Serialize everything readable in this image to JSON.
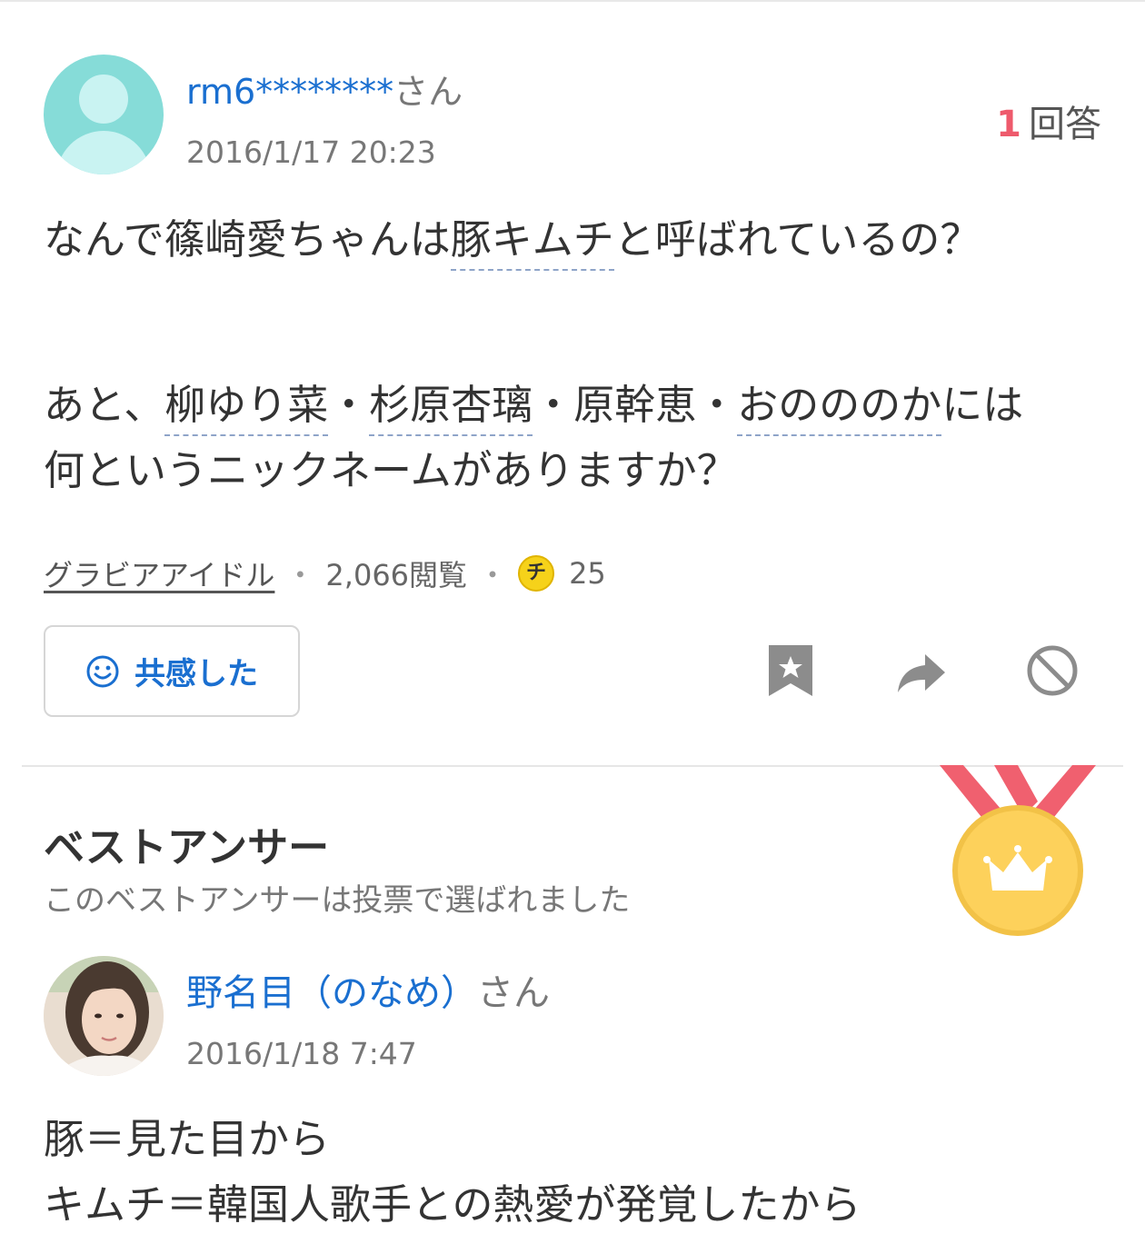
{
  "question": {
    "user_name": "rm6********",
    "user_suffix": "さん",
    "date": "2016/1/17 20:23",
    "answer_count": "1",
    "answer_count_label": "回答",
    "line1_pre": "なんで篠崎愛ちゃんは",
    "line1_kw": "豚キムチ",
    "line1_post": "と呼ばれているの？",
    "line2_pre": "あと、",
    "line2_kw1": "柳ゆり菜",
    "line2_sep1": "・",
    "line2_kw2": "杉原杏璃",
    "line2_mid": "・原幹恵・",
    "line2_kw3": "おのののか",
    "line2_post": "には",
    "line3": "何というニックネームがありますか？",
    "category": "グラビアアイドル",
    "views": "2,066閲覧",
    "coin_symbol": "チ",
    "coins": "25",
    "sep": "・"
  },
  "actions": {
    "empathy_label": "共感した",
    "icons": [
      "smile-icon",
      "bookmark-star-icon",
      "share-arrow-icon",
      "block-icon"
    ]
  },
  "best_answer": {
    "title": "ベストアンサー",
    "subtitle": "このベストアンサーは投票で選ばれました",
    "user_name": "野名目（のなめ）",
    "user_suffix": "さん",
    "date": "2016/1/18 7:47",
    "line1": "豚＝見た目から",
    "line2": "キムチ＝韓国人歌手との熱愛が発覚したから"
  },
  "colors": {
    "link_blue": "#1a6fd0",
    "accent_red": "#ee5a6c",
    "medal_gold": "#fdd15b",
    "ribbon": "#f0606f",
    "avatar_teal": "#86dcd8"
  }
}
